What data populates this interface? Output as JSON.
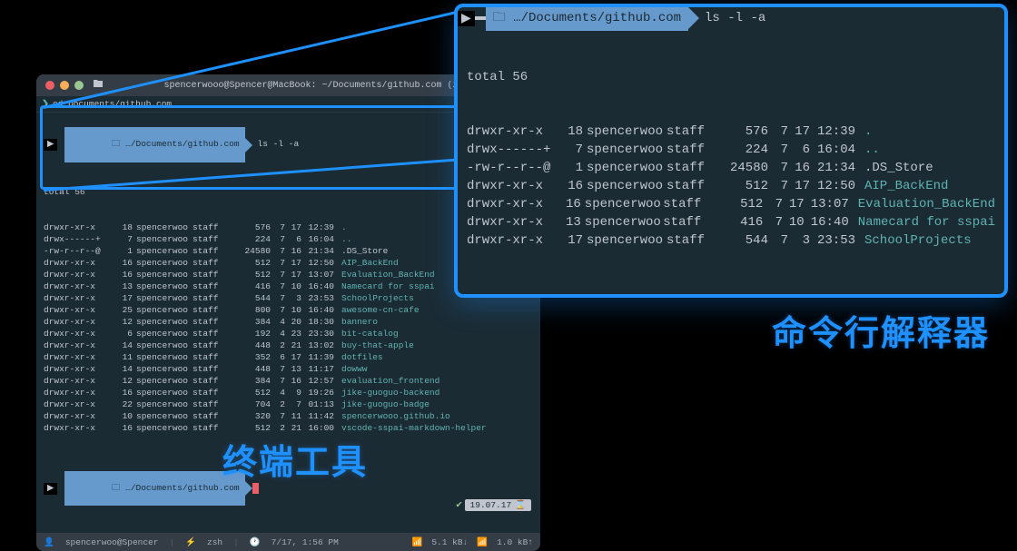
{
  "labels": {
    "terminal_tool": "终端工具",
    "shell_interpreter": "命令行解释器"
  },
  "window": {
    "title": "spencerwooo@Spencer@MacBook: ~/Documents/github.com (zsh)",
    "tab_prefix": "cd Documents/github.com",
    "user_host": "spencerwoo@Spencer",
    "shell": "zsh",
    "clock": "7/17, 1:56 PM",
    "net_down": "5.1 kB↓",
    "net_up": "1.0 kB↑",
    "date_pill": "19.07.17"
  },
  "prompt": {
    "path_short": "…/Documents/github.com",
    "command": "ls -l -a"
  },
  "total_line": "total 56",
  "rows": [
    {
      "perm": "drwxr-xr-x",
      "links": "18",
      "user": "spencerwoo",
      "group": "staff",
      "size": "576",
      "mon": "7",
      "day": "17",
      "time": "12:39",
      "name": ".",
      "cls": "fg-cyan"
    },
    {
      "perm": "drwx------+",
      "links": "7",
      "user": "spencerwoo",
      "group": "staff",
      "size": "224",
      "mon": "7",
      "day": "6",
      "time": "16:04",
      "name": "..",
      "cls": "fg-cyan"
    },
    {
      "perm": "-rw-r--r--@",
      "links": "1",
      "user": "spencerwoo",
      "group": "staff",
      "size": "24580",
      "mon": "7",
      "day": "16",
      "time": "21:34",
      "name": ".DS_Store",
      "cls": "fg-default"
    },
    {
      "perm": "drwxr-xr-x",
      "links": "16",
      "user": "spencerwoo",
      "group": "staff",
      "size": "512",
      "mon": "7",
      "day": "17",
      "time": "12:50",
      "name": "AIP_BackEnd",
      "cls": "fg-cyan"
    },
    {
      "perm": "drwxr-xr-x",
      "links": "16",
      "user": "spencerwoo",
      "group": "staff",
      "size": "512",
      "mon": "7",
      "day": "17",
      "time": "13:07",
      "name": "Evaluation_BackEnd",
      "cls": "fg-cyan"
    },
    {
      "perm": "drwxr-xr-x",
      "links": "13",
      "user": "spencerwoo",
      "group": "staff",
      "size": "416",
      "mon": "7",
      "day": "10",
      "time": "16:40",
      "name": "Namecard for sspai",
      "cls": "fg-cyan"
    },
    {
      "perm": "drwxr-xr-x",
      "links": "17",
      "user": "spencerwoo",
      "group": "staff",
      "size": "544",
      "mon": "7",
      "day": "3",
      "time": "23:53",
      "name": "SchoolProjects",
      "cls": "fg-cyan"
    },
    {
      "perm": "drwxr-xr-x",
      "links": "25",
      "user": "spencerwoo",
      "group": "staff",
      "size": "800",
      "mon": "7",
      "day": "10",
      "time": "16:40",
      "name": "awesome-cn-cafe",
      "cls": "fg-teal"
    },
    {
      "perm": "drwxr-xr-x",
      "links": "12",
      "user": "spencerwoo",
      "group": "staff",
      "size": "384",
      "mon": "4",
      "day": "20",
      "time": "18:30",
      "name": "bannero",
      "cls": "fg-teal"
    },
    {
      "perm": "drwxr-xr-x",
      "links": "6",
      "user": "spencerwoo",
      "group": "staff",
      "size": "192",
      "mon": "4",
      "day": "23",
      "time": "23:30",
      "name": "bit-catalog",
      "cls": "fg-teal"
    },
    {
      "perm": "drwxr-xr-x",
      "links": "14",
      "user": "spencerwoo",
      "group": "staff",
      "size": "448",
      "mon": "2",
      "day": "21",
      "time": "13:02",
      "name": "buy-that-apple",
      "cls": "fg-teal"
    },
    {
      "perm": "drwxr-xr-x",
      "links": "11",
      "user": "spencerwoo",
      "group": "staff",
      "size": "352",
      "mon": "6",
      "day": "17",
      "time": "11:39",
      "name": "dotfiles",
      "cls": "fg-teal"
    },
    {
      "perm": "drwxr-xr-x",
      "links": "14",
      "user": "spencerwoo",
      "group": "staff",
      "size": "448",
      "mon": "7",
      "day": "13",
      "time": "11:17",
      "name": "dowww",
      "cls": "fg-teal"
    },
    {
      "perm": "drwxr-xr-x",
      "links": "12",
      "user": "spencerwoo",
      "group": "staff",
      "size": "384",
      "mon": "7",
      "day": "16",
      "time": "12:57",
      "name": "evaluation_frontend",
      "cls": "fg-teal"
    },
    {
      "perm": "drwxr-xr-x",
      "links": "16",
      "user": "spencerwoo",
      "group": "staff",
      "size": "512",
      "mon": "4",
      "day": "9",
      "time": "19:26",
      "name": "jike-guoguo-backend",
      "cls": "fg-teal"
    },
    {
      "perm": "drwxr-xr-x",
      "links": "22",
      "user": "spencerwoo",
      "group": "staff",
      "size": "704",
      "mon": "2",
      "day": "7",
      "time": "01:13",
      "name": "jike-guoguo-badge",
      "cls": "fg-teal"
    },
    {
      "perm": "drwxr-xr-x",
      "links": "10",
      "user": "spencerwoo",
      "group": "staff",
      "size": "320",
      "mon": "7",
      "day": "11",
      "time": "11:42",
      "name": "spencerwooo.github.io",
      "cls": "fg-teal"
    },
    {
      "perm": "drwxr-xr-x",
      "links": "16",
      "user": "spencerwoo",
      "group": "staff",
      "size": "512",
      "mon": "2",
      "day": "21",
      "time": "16:00",
      "name": "vscode-sspai-markdown-helper",
      "cls": "fg-teal"
    }
  ],
  "zoom_rows_count": 7
}
